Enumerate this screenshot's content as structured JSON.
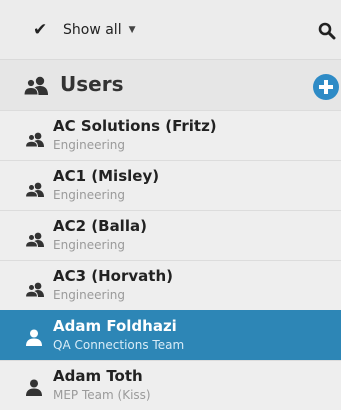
{
  "toolbar": {
    "filter_icon": "check-icon",
    "filter_label": "Show all",
    "caret_icon": "caret-down-icon",
    "search_icon": "search-icon"
  },
  "section": {
    "icon": "users-icon",
    "title": "Users",
    "add_icon": "add-circle-icon"
  },
  "items": [
    {
      "name": "AC Solutions (Fritz)",
      "subtitle": "Engineering",
      "icon": "group-icon",
      "selected": false
    },
    {
      "name": "AC1 (Misley)",
      "subtitle": "Engineering",
      "icon": "group-icon",
      "selected": false
    },
    {
      "name": "AC2 (Balla)",
      "subtitle": "Engineering",
      "icon": "group-icon",
      "selected": false
    },
    {
      "name": "AC3 (Horvath)",
      "subtitle": "Engineering",
      "icon": "group-icon",
      "selected": false
    },
    {
      "name": "Adam Foldhazi",
      "subtitle": "QA Connections Team",
      "icon": "user-icon",
      "selected": true
    },
    {
      "name": "Adam Toth",
      "subtitle": "MEP Team (Kiss)",
      "icon": "user-icon",
      "selected": false
    }
  ],
  "colors": {
    "accent": "#2d86b6",
    "add_button": "#2e8bc6",
    "toolbar_bg": "#ececec",
    "row_bg": "#eeeeee"
  }
}
